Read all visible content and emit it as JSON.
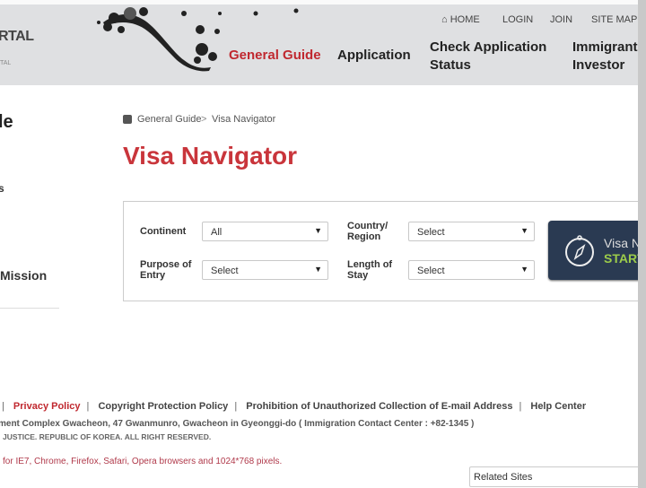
{
  "header": {
    "logo_text": "RTAL",
    "logo_subtext": "TAL",
    "util_links": [
      {
        "label": "HOME",
        "icon": "home-icon"
      },
      {
        "label": "LOGIN"
      },
      {
        "label": "JOIN"
      },
      {
        "label": "SITE MAP"
      }
    ],
    "nav": [
      {
        "label": "General Guide",
        "active": true
      },
      {
        "label": "Application"
      },
      {
        "label": "Check Application Status"
      },
      {
        "label": "Immigrant Investor"
      }
    ]
  },
  "sidebar": {
    "title": "le",
    "items": [
      "s",
      "Mission"
    ]
  },
  "breadcrumb": {
    "items": [
      "General Guide",
      "Visa Navigator"
    ],
    "separator": ">"
  },
  "page_title": "Visa Navigator",
  "form": {
    "continent": {
      "label": "Continent",
      "value": "All"
    },
    "country": {
      "label": "Country/ Region",
      "value": "Select"
    },
    "purpose": {
      "label": "Purpose of Entry",
      "value": "Select"
    },
    "length": {
      "label": "Length of Stay",
      "value": "Select"
    },
    "start_button": {
      "title": "Visa Na",
      "label": "START",
      "icon": "compass-icon"
    }
  },
  "footer": {
    "links": [
      "Privacy Policy",
      "Copyright Protection Policy",
      "Prohibition of Unauthorized Collection of E-mail Address",
      "Help Center"
    ],
    "address": "ment Complex Gwacheon, 47 Gwanmunro, Gwacheon in Gyeonggi-do ( Immigration Contact Center : +82-1345 )",
    "copyright": "JUSTICE. REPUBLIC OF KOREA. ALL RIGHT RESERVED.",
    "browser_note": "for IE7, Chrome, Firefox, Safari, Opera browsers and 1024*768 pixels.",
    "related_sites": "Related Sites"
  },
  "colors": {
    "accent": "#c9353b",
    "header_bg": "#dfe0e2",
    "button_bg": "#2a3a52",
    "start_green": "#9ccc4a"
  }
}
